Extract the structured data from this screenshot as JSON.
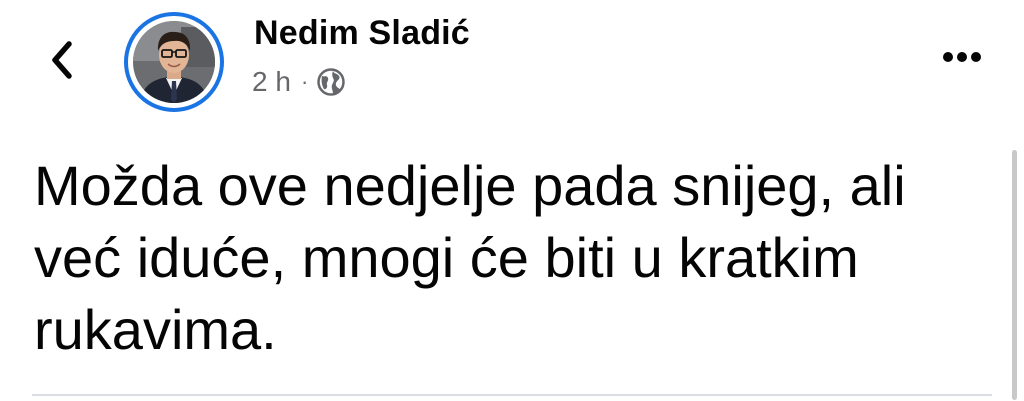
{
  "post": {
    "author_name": "Nedim Sladić",
    "time_ago": "2 h",
    "separator": "·",
    "audience_icon": "globe-icon",
    "text": "Možda ove nedjelje pada snijeg, ali već iduće, mnogi će biti u kratkim rukavima."
  },
  "nav": {
    "back_icon": "chevron-left-icon",
    "more_icon": "more-horizontal-icon"
  },
  "colors": {
    "story_ring": "#1b74e4",
    "meta_text": "#65676b",
    "divider": "#dadde1"
  }
}
